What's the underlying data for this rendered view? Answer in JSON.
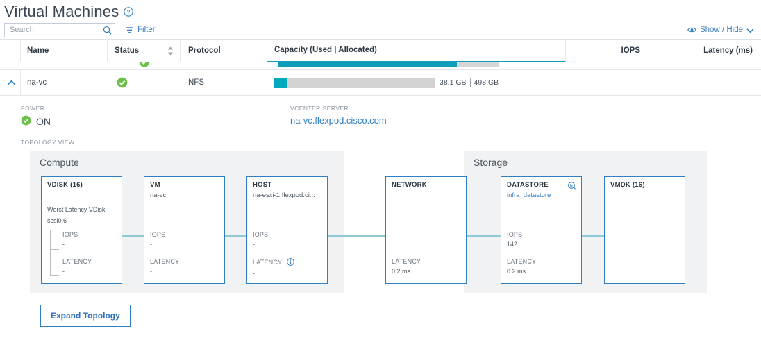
{
  "page": {
    "title": "Virtual Machines",
    "help_icon": "help-circle-icon"
  },
  "toolbar": {
    "search_placeholder": "Search",
    "search_value": "",
    "search_icon": "search-icon",
    "filter_label": "Filter",
    "filter_icon": "filter-icon",
    "show_hide_label": "Show / Hide",
    "show_hide_icon": "eye-icon",
    "show_hide_chevron": "chevron-down-icon"
  },
  "table": {
    "columns": [
      {
        "key": "expand",
        "label": ""
      },
      {
        "key": "name",
        "label": "Name"
      },
      {
        "key": "status",
        "label": "Status"
      },
      {
        "key": "protocol",
        "label": "Protocol"
      },
      {
        "key": "capacity",
        "label": "Capacity (Used | Allocated)"
      },
      {
        "key": "iops",
        "label": "IOPS"
      },
      {
        "key": "latency",
        "label": "Latency (ms)"
      }
    ],
    "sort_icon": "sort-arrows-icon",
    "row": {
      "expand_icon": "chevron-up-icon",
      "name": "na-vc",
      "status": "ok",
      "status_icon": "status-ok-icon",
      "protocol": "NFS",
      "capacity_used": "38.1 GB",
      "capacity_allocated": "498 GB",
      "capacity_fill_percent": 8,
      "iops": "",
      "latency": ""
    }
  },
  "detail": {
    "power_label": "POWER",
    "power_value": "ON",
    "power_icon": "status-ok-icon",
    "vcenter_label": "VCENTER SERVER",
    "vcenter_value": "na-vc.flexpod.cisco.com",
    "topology_label": "TOPOLOGY VIEW",
    "expand_button": "Expand Topology"
  },
  "topology": {
    "zones": [
      {
        "key": "compute",
        "title": "Compute"
      },
      {
        "key": "storage",
        "title": "Storage"
      }
    ],
    "nodes": [
      {
        "key": "vdisk",
        "type": "VDISK (16)",
        "name": "",
        "sub_title": "Worst Latency VDisk",
        "sub_name": "scsi0:6",
        "iops_label": "IOPS",
        "iops_value": "-",
        "latency_label": "LATENCY",
        "latency_value": "-"
      },
      {
        "key": "vm",
        "type": "VM",
        "name": "na-vc",
        "iops_label": "IOPS",
        "iops_value": "-",
        "latency_label": "LATENCY",
        "latency_value": "-"
      },
      {
        "key": "host",
        "type": "HOST",
        "name": "na-esxi-1.flexpod.ci...",
        "iops_label": "IOPS",
        "iops_value": "-",
        "latency_label": "LATENCY",
        "latency_value": "-",
        "latency_info_icon": "info-icon"
      },
      {
        "key": "network",
        "type": "NETWORK",
        "name": "",
        "latency_label": "LATENCY",
        "latency_value": "0.2 ms"
      },
      {
        "key": "datastore",
        "type": "DATASTORE",
        "name": "infra_datastore",
        "header_icon": "magnifier-detail-icon",
        "iops_label": "IOPS",
        "iops_value": "142",
        "latency_label": "LATENCY",
        "latency_value": "0.2 ms"
      },
      {
        "key": "vmdk",
        "type": "VMDK (16)",
        "name": ""
      }
    ]
  },
  "colors": {
    "accent_blue": "#2f7fc2",
    "link_blue": "#2f7fc2",
    "status_green": "#6cc04a",
    "capacity_teal": "#00a9c0",
    "connector": "#8fc9d4",
    "zone_bg": "#f1f2f3"
  }
}
